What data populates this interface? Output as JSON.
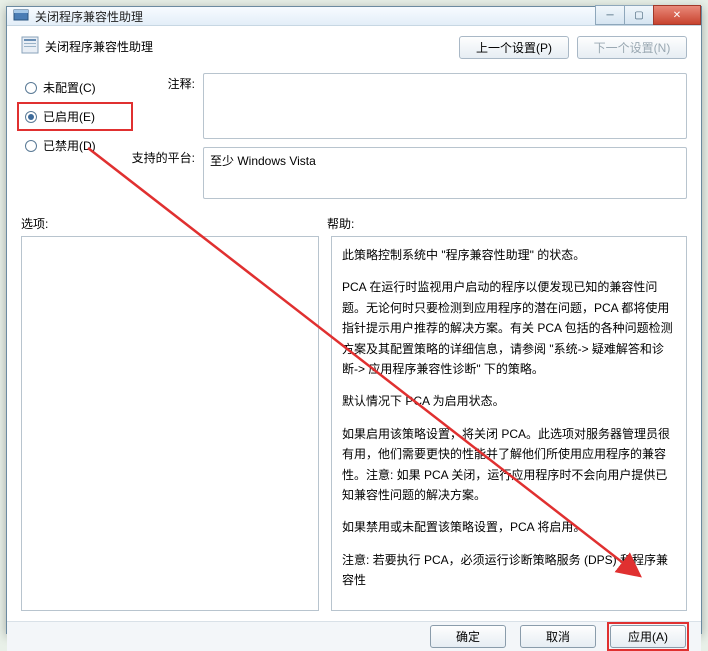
{
  "window": {
    "title": "关闭程序兼容性助理"
  },
  "header": {
    "pageTitle": "关闭程序兼容性助理",
    "prevButton": "上一个设置(P)",
    "nextButton": "下一个设置(N)"
  },
  "radios": {
    "notConfigured": "未配置(C)",
    "enabled": "已启用(E)",
    "disabled": "已禁用(D)"
  },
  "fields": {
    "commentLabel": "注释:",
    "commentValue": "",
    "platformLabel": "支持的平台:",
    "platformValue": "至少 Windows Vista"
  },
  "sections": {
    "optionsLabel": "选项:",
    "helpLabel": "帮助:"
  },
  "help": {
    "p1": "此策略控制系统中 \"程序兼容性助理\" 的状态。",
    "p2": "PCA 在运行时监视用户启动的程序以便发现已知的兼容性问题。无论何时只要检测到应用程序的潜在问题，PCA 都将使用指针提示用户推荐的解决方案。有关 PCA 包括的各种问题检测方案及其配置策略的详细信息，请参阅 \"系统-> 疑难解答和诊断-> 应用程序兼容性诊断\" 下的策略。",
    "p3": "默认情况下 PCA 为启用状态。",
    "p4": "如果启用该策略设置，将关闭 PCA。此选项对服务器管理员很有用，他们需要更快的性能并了解他们所使用应用程序的兼容性。注意: 如果 PCA 关闭，运行应用程序时不会向用户提供已知兼容性问题的解决方案。",
    "p5": "如果禁用或未配置该策略设置，PCA 将启用。",
    "p6": "注意: 若要执行 PCA，必须运行诊断策略服务 (DPS) 和程序兼容性"
  },
  "footer": {
    "ok": "确定",
    "cancel": "取消",
    "apply": "应用(A)"
  }
}
